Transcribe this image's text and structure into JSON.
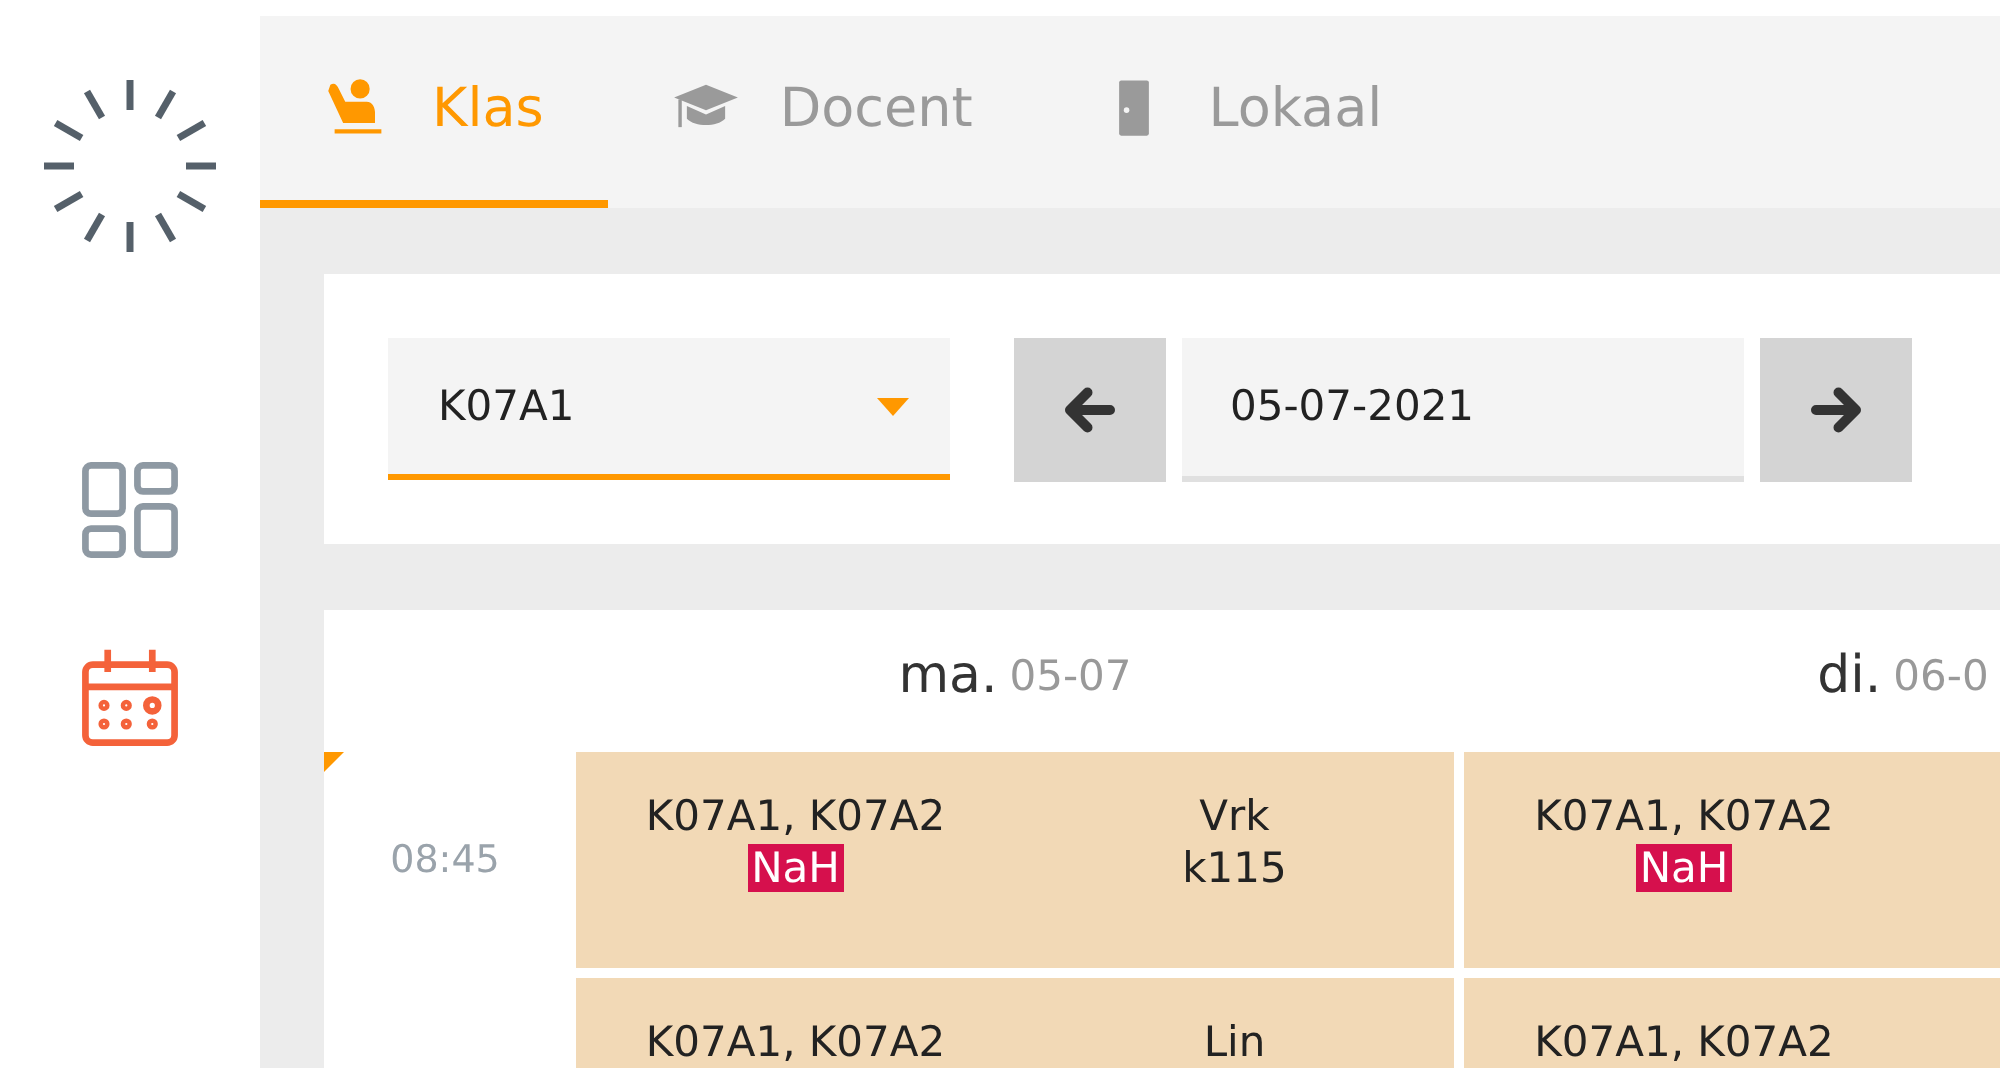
{
  "sidebar": {
    "items": [
      {
        "kind": "dashboard",
        "selected": false
      },
      {
        "kind": "calendar",
        "selected": true
      }
    ]
  },
  "tabs": [
    {
      "label": "Klas",
      "kind": "class",
      "selected": true
    },
    {
      "label": "Docent",
      "kind": "teacher",
      "selected": false
    },
    {
      "label": "Lokaal",
      "kind": "room",
      "selected": false
    }
  ],
  "filters": {
    "class_select": {
      "value": "K07A1"
    },
    "date_field": {
      "value": "05-07-2021"
    }
  },
  "schedule": {
    "days": [
      {
        "weekday": "ma.",
        "date": "05-07"
      },
      {
        "weekday": "di.",
        "date": "06-0"
      }
    ],
    "rows": [
      {
        "time": "08:45",
        "lessons": [
          {
            "groups": "K07A1, K07A2",
            "tag": "NaH",
            "subject": "Vrk",
            "room": "k115"
          },
          {
            "groups": "K07A1, K07A2",
            "tag": "NaH"
          }
        ]
      },
      {
        "lessons": [
          {
            "groups": "K07A1, K07A2",
            "subject": "Lin"
          },
          {
            "groups": "K07A1, K07A2"
          }
        ]
      }
    ]
  }
}
